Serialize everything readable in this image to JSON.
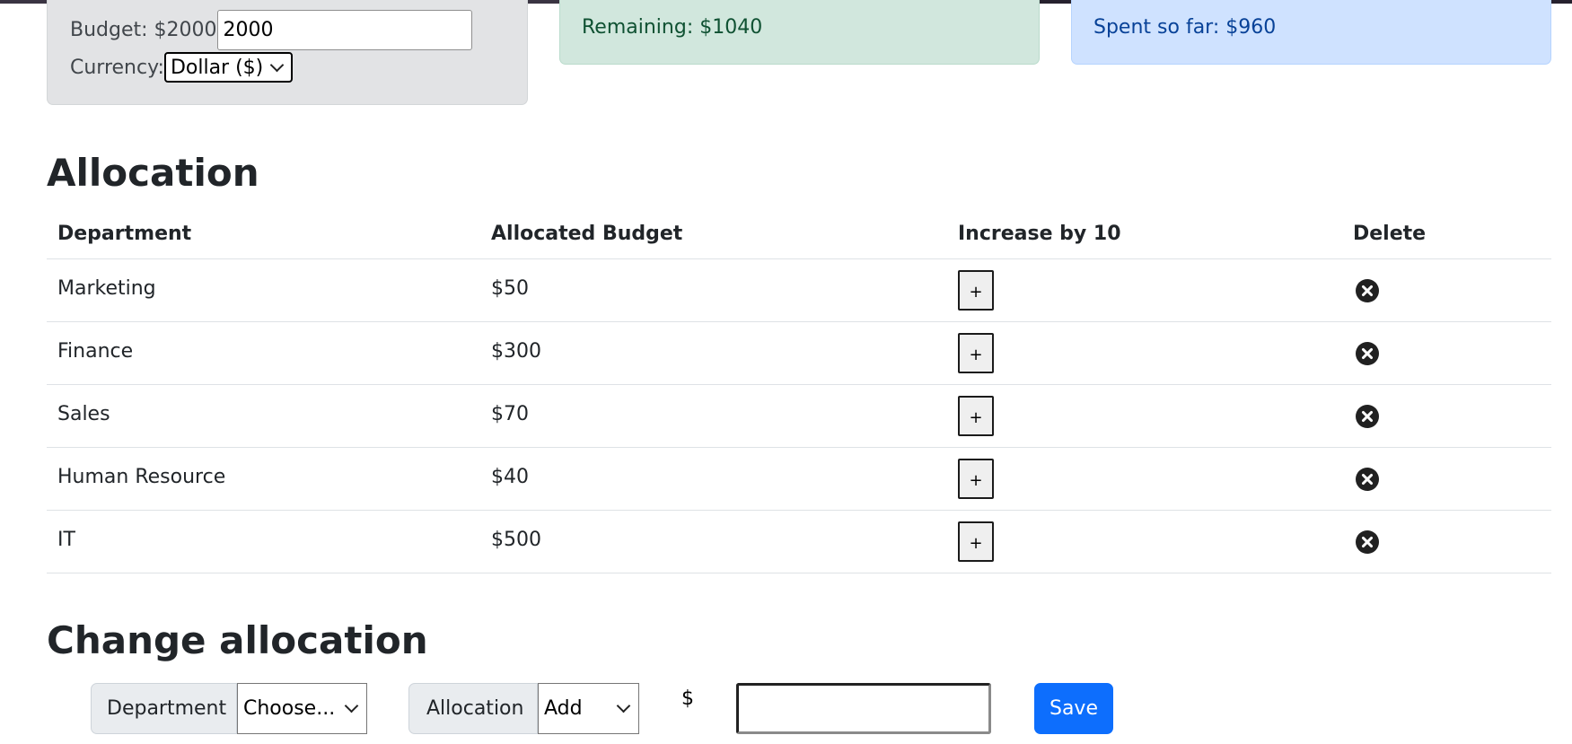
{
  "budget": {
    "label": "Budget: $2000",
    "input_value": "2000",
    "currency_label": "Currency:",
    "currency_selected": "Dollar ($)"
  },
  "remaining": {
    "text": "Remaining: $1040"
  },
  "spent": {
    "text": "Spent so far: $960"
  },
  "allocation": {
    "title": "Allocation",
    "headers": [
      "Department",
      "Allocated Budget",
      "Increase by 10",
      "Delete"
    ],
    "increase_label": "+",
    "rows": [
      {
        "department": "Marketing",
        "budget": "$50"
      },
      {
        "department": "Finance",
        "budget": "$300"
      },
      {
        "department": "Sales",
        "budget": "$70"
      },
      {
        "department": "Human Resource",
        "budget": "$40"
      },
      {
        "department": "IT",
        "budget": "$500"
      }
    ]
  },
  "change": {
    "title": "Change allocation",
    "department_label": "Department",
    "department_selected": "Choose...",
    "allocation_label": "Allocation",
    "allocation_selected": "Add",
    "currency_symbol": "$",
    "amount_value": "",
    "save_label": "Save"
  },
  "colors": {
    "remaining_bg": "#d1e7dd",
    "spent_bg": "#cfe2ff",
    "budget_bg": "#e2e3e5",
    "primary": "#0d6efd"
  },
  "icons": {
    "delete": "x-circle-fill-icon",
    "dropdown": "chevron-down-icon"
  }
}
